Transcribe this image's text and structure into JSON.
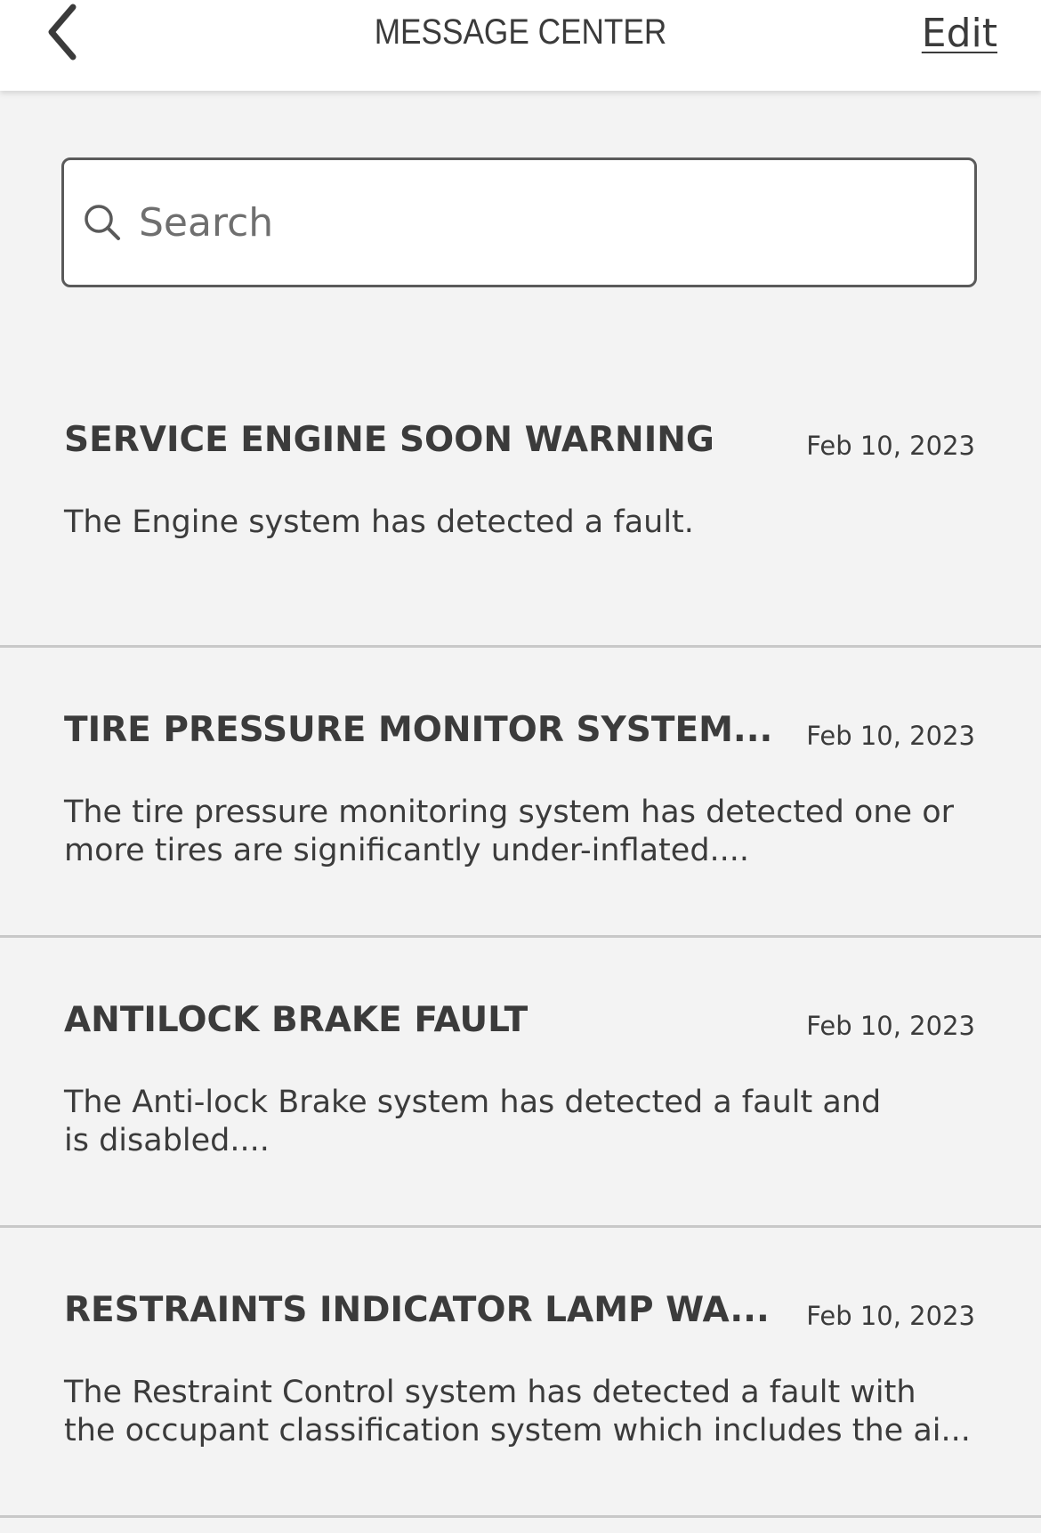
{
  "header": {
    "title": "MESSAGE CENTER",
    "edit_label": "Edit",
    "back_icon": "chevron-left-icon"
  },
  "search": {
    "placeholder": "Search",
    "value": "",
    "icon": "search-icon"
  },
  "messages": [
    {
      "title": "SERVICE ENGINE SOON WARNING",
      "date": "Feb 10, 2023",
      "body": "The Engine system has detected a fault."
    },
    {
      "title": "TIRE PRESSURE MONITOR SYSTEM...",
      "date": "Feb 10, 2023",
      "body": "The tire pressure monitoring system has detected one or\nmore tires are significantly under-inflated...."
    },
    {
      "title": "ANTILOCK BRAKE FAULT",
      "date": "Feb 10, 2023",
      "body": "The Anti-lock Brake system has detected a fault and\nis disabled...."
    },
    {
      "title": "RESTRAINTS INDICATOR LAMP WA...",
      "date": "Feb 10, 2023",
      "body": "The Restraint Control system has detected a fault with\nthe occupant classification system which includes the ai..."
    }
  ]
}
